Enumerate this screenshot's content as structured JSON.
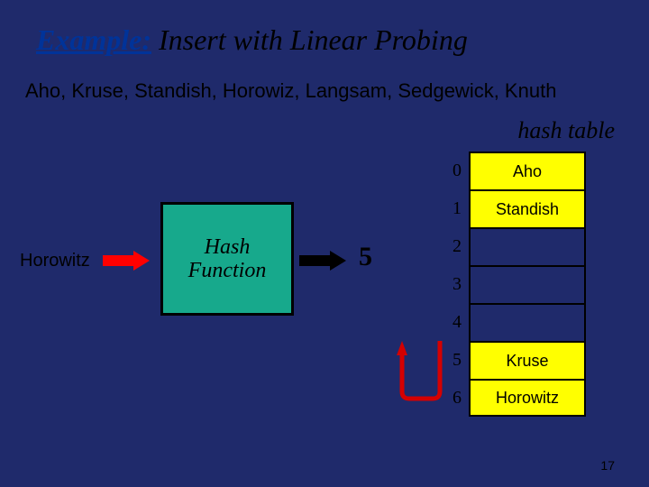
{
  "title": {
    "prefix": "Example:",
    "rest": "Insert with Linear Probing"
  },
  "names_line": "Aho, Kruse, Standish, Horowiz, Langsam, Sedgewick, Knuth",
  "table_caption": "hash table",
  "input_label": "Horowitz",
  "hash_function_label": "Hash Function",
  "hash_result": "5",
  "hash_table": {
    "rows": [
      {
        "index": "0",
        "value": "Aho",
        "filled": true
      },
      {
        "index": "1",
        "value": "Standish",
        "filled": true
      },
      {
        "index": "2",
        "value": "",
        "filled": false
      },
      {
        "index": "3",
        "value": "",
        "filled": false
      },
      {
        "index": "4",
        "value": "",
        "filled": false
      },
      {
        "index": "5",
        "value": "Kruse",
        "filled": true
      },
      {
        "index": "6",
        "value": "Horowitz",
        "filled": true
      }
    ]
  },
  "slide_number": "17",
  "colors": {
    "background": "#1f2a6b",
    "hash_box": "#17a98c",
    "filled_cell": "#ffff00",
    "arrow_input": "#ff0000",
    "arrow_output": "#000000",
    "probe_arrow": "#d40000"
  }
}
